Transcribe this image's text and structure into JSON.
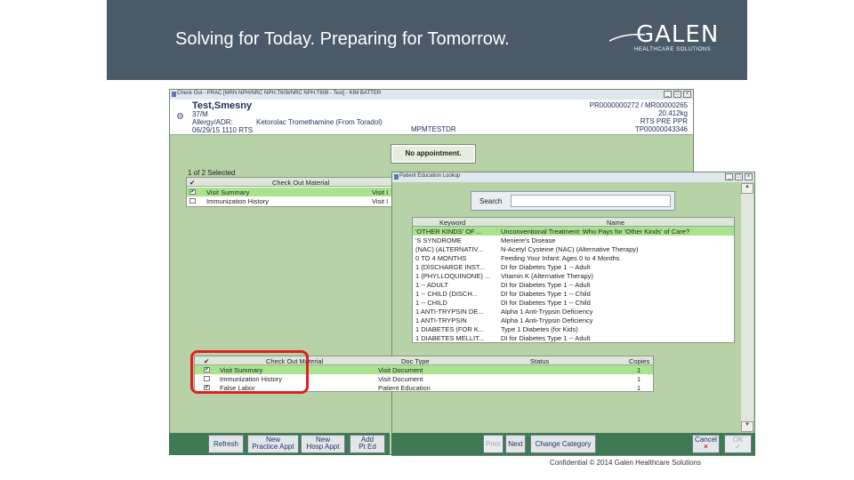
{
  "slide": {
    "tagline": "Solving for Today. Preparing for Tomorrow.",
    "logo_name": "GALEN",
    "logo_sub": "HEALTHCARE SOLUTIONS",
    "confidential": "Confidential © 2014 Galen Healthcare Solutions",
    "banner_color": "#4a5a68"
  },
  "checkout_window": {
    "title": "Check Out - PRAC [MRN NPH/NRC NPH.T608/NRC NPH.T608 - Test] - KIM BATTER",
    "controls": [
      "_",
      "□",
      "×"
    ],
    "patient": {
      "name": "Test,Smesny",
      "age_sex": "37/M",
      "allergy_label": "Allergy/ADR:",
      "allergy_value": "Ketorolac Tromethamine (From Toradol)",
      "datetime": "06/29/15 1110 RTS",
      "code": "MPMTESTDR",
      "ids": "PR0000000272 / MR00000265",
      "weight": "20.412kg",
      "type": "RTS PRE PPR",
      "account": "TP00000043346"
    },
    "appointment_button": "No appointment.",
    "selected_count": "1 of 2 Selected",
    "material_grid": {
      "headers": [
        "✔",
        "Check Out Material"
      ],
      "rows": [
        {
          "checked": true,
          "material": "Visit Summary",
          "extra": "Visit I"
        },
        {
          "checked": false,
          "material": "Immunization History",
          "extra": "Visit I"
        }
      ]
    },
    "document_grid": {
      "headers": [
        "✔",
        "Check Out Material",
        "Doc Type",
        "Status",
        "Copies"
      ],
      "rows": [
        {
          "checked": true,
          "material": "Visit Summary",
          "doc_type": "Visit Document",
          "status": "",
          "copies": "1"
        },
        {
          "checked": false,
          "material": "Immunization History",
          "doc_type": "Visit Document",
          "status": "",
          "copies": "1"
        },
        {
          "checked": true,
          "material": "False Labor",
          "doc_type": "Patient Education",
          "status": "",
          "copies": "1"
        }
      ]
    },
    "footer_buttons": [
      {
        "label": "Refresh"
      },
      {
        "label": "New Practice Appt",
        "line1": "New",
        "line2": "Practice Appt"
      },
      {
        "label": "New Hosp Appt",
        "line1": "New",
        "line2": "Hosp Appt"
      },
      {
        "label": "Add Pt Ed",
        "line1": "Add",
        "line2": "Pt Ed"
      }
    ]
  },
  "education_window": {
    "title": "Patient Education Lookup",
    "controls": [
      "_",
      "□",
      "×"
    ],
    "search_label": "Search",
    "search_value": "",
    "grid": {
      "headers": [
        "Keyword",
        "Name"
      ],
      "rows": [
        {
          "keyword": "'OTHER KINDS' OF ...",
          "name": "Unconventional Treatment: Who Pays for 'Other Kinds' of Care?"
        },
        {
          "keyword": "'S SYNDROME",
          "name": "Meniere's Disease"
        },
        {
          "keyword": "(NAC) (ALTERNATIV...",
          "name": "N-Acetyl Cysteine (NAC) (Alternative Therapy)"
        },
        {
          "keyword": "0 TO 4 MONTHS",
          "name": "Feeding Your Infant: Ages 0 to 4 Months"
        },
        {
          "keyword": "1 (DISCHARGE INST...",
          "name": "DI for Diabetes Type 1 -- Adult"
        },
        {
          "keyword": "1 (PHYLLOQUINONE) ...",
          "name": "Vitamin K (Alternative Therapy)"
        },
        {
          "keyword": "1 -- ADULT",
          "name": "DI for Diabetes Type 1 -- Adult"
        },
        {
          "keyword": "1 -- CHILD (DISCH...",
          "name": "DI for Diabetes Type 1 -- Child"
        },
        {
          "keyword": "1 -- CHILD",
          "name": "DI for Diabetes Type 1 -- Child"
        },
        {
          "keyword": "1 ANTI-TRYPSIN DE...",
          "name": "Alpha 1 Anti-Trypsin Deficiency"
        },
        {
          "keyword": "1 ANTI-TRYPSIN",
          "name": "Alpha 1 Anti-Trypsin Deficiency"
        },
        {
          "keyword": "1 DIABETES (FOR K...",
          "name": "Type 1 Diabetes (for Kids)"
        },
        {
          "keyword": "1 DIABETES MELLIT...",
          "name": "DI for Diabetes Type 1 -- Adult"
        }
      ]
    },
    "footer_buttons": [
      {
        "label": "Prior",
        "enabled": false
      },
      {
        "label": "Next",
        "enabled": true
      },
      {
        "label": "Change Category",
        "enabled": true
      },
      {
        "label": "Cancel",
        "enabled": true,
        "mark": "×"
      },
      {
        "label": "OK",
        "enabled": false,
        "mark": "✓"
      }
    ]
  }
}
